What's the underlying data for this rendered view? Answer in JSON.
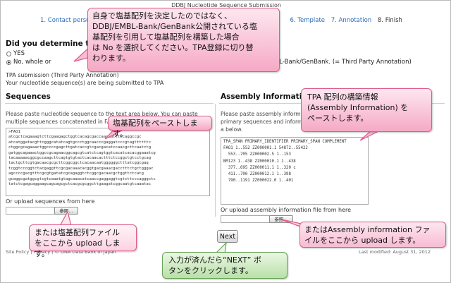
{
  "window_title": "DDBJ Nucleotide Sequence Submission",
  "steps": [
    {
      "label": "1. Contact person",
      "current": false
    },
    {
      "label": "6. Template",
      "current": false
    },
    {
      "label": "7. Annotation",
      "current": false
    },
    {
      "label": "8. Finish",
      "current": true
    }
  ],
  "question": {
    "title": "Did you determine the",
    "options": [
      {
        "label": "YES",
        "selected": false
      },
      {
        "label": "No, whole or",
        "selected": true
      }
    ],
    "option_tail": "rom DDBJ/EMBL-Bank/GenBank. (= Third Party Annotation)"
  },
  "tpa": {
    "line1": "TPA submission (Third Party Annotation)",
    "line2": "Your nucleotide sequence(s) are being submitted to TPA"
  },
  "sequences": {
    "title": "Sequences",
    "desc_line1": "Please paste nucleotide sequence to the text area below. You can paste",
    "desc_line2": "multiple sequences concatenated in FAS",
    "textarea_value": ">FAO1\natcgctcagaaagtcttcgaagagctggtcacagcgaccaagaatttccaggccgc\natcatggatacgttcgggcatatcagtgccctggcaacccgaggatcccgtagttttttc\nctggcgcagaaactggccccgagcttgatcaccgtcgacgacatccaacgcttcaatctg\ngatggcagaaactggccgcagaacggcagcgtcatctcagtggtcacatcacacggaaatcg\ntacaaaaacggcgccaagcttcagtgtgtactcacaacactttctccggctgtcctgcag\ntactgcttcgtgacaacgcgcttcggcggctcacaacaatggggggctttatcggcgag\ntcggtcccggtctacgaggttcgcgacaaacacggtgacgaaacgacctttctgctgggac\nagccccgacgtttcgcgtgatatcgcagaggtctcggcgacaacgctggttctcatg\ngcaggcgatggcgtcgtcaaatgtagcaaacatcaaccgaggaggtcgtcttcccagggctc\ntatctcgagcaggaagcagcagcgctcacgcgcggcttgaagatcggcaatgtcaaatac",
    "upload_label": "Or upload sequences from here",
    "browse_label": "参照..."
  },
  "assembly": {
    "title": "Assembly Information",
    "desc_line1": "Please paste assembly informatio",
    "desc_line2": "primary sequences and informatio",
    "desc_line3": "a below.",
    "textarea_value": "TPA_SPAN PRIMARY_IDENTIFIER PRIMARY_SPAN COMPLEMENT\nFAO1 1..552 ZZ000001.1 54872..55422\n  553..705 ZZ000002.5 1..153\nBM123 1..438 ZZ000010.1 1..438\n  377..695 ZZ000011.1 1..320 c\n  411..790 ZZ000012.1 1..398\n  790..1191 ZZ000022.0 1..401",
    "upload_label": "Or upload assembly information file from here",
    "browse_label": "参照..."
  },
  "next_label": "Next",
  "footer": {
    "left": "Site Policy | Privacy | © DNA Data Bank of Japan",
    "right": "Last modified: August 31, 2012"
  },
  "callouts": {
    "top": {
      "lines": [
        "自身で塩基配列を決定したのではなく、",
        "DDBJ/EMBL-Bank/GenBank公開されている塩",
        "基配列を引用して塩基配列を構築した場合",
        "は No を選択してください。TPA登録に切り替",
        "わります。"
      ]
    },
    "paste_seq": {
      "lines": [
        "塩基配列をペーストします。"
      ]
    },
    "assembly_info": {
      "lines": [
        "TPA 配列の構築情報",
        "(Assembly Information) を",
        "ペーストします。"
      ]
    },
    "upload_seq": {
      "lines": [
        "または塩基配列ファイル",
        "をここから upload します。"
      ]
    },
    "upload_assembly": {
      "lines": [
        "またはAssembly information ファ",
        "イルをここから upload します。"
      ]
    },
    "next_hint": {
      "lines": [
        "入力が済んだら“NEXT” ボ",
        "タンをクリックします。"
      ]
    }
  },
  "colors": {
    "callout_pink": "#f6a9c5",
    "callout_green": "#b9e0a8",
    "link_blue": "#2a6cb8"
  }
}
